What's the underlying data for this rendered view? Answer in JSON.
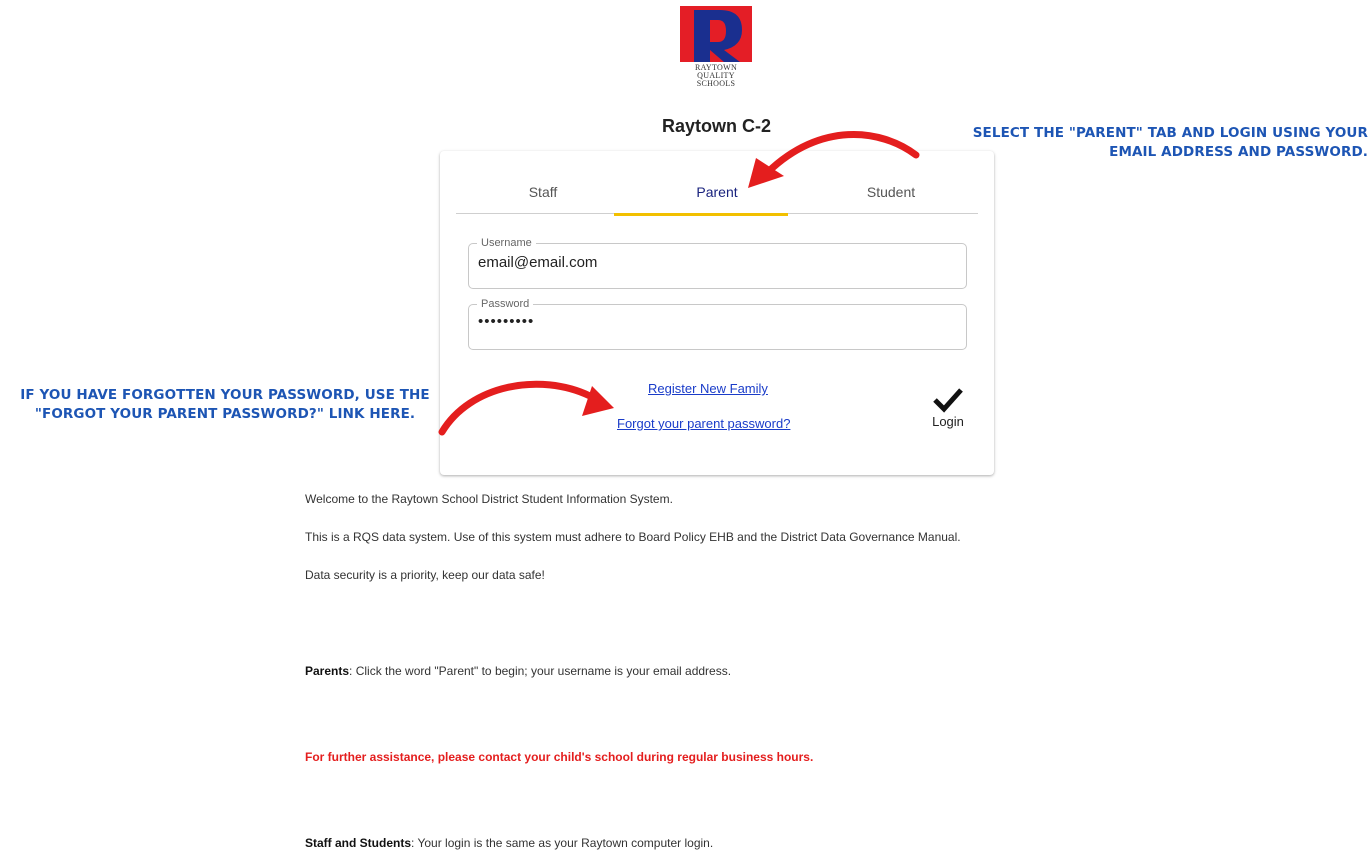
{
  "logo": {
    "lines": [
      "RAYTOWN",
      "QUALITY",
      "SCHOOLS"
    ]
  },
  "title": "Raytown C-2",
  "tabs": [
    {
      "label": "Staff"
    },
    {
      "label": "Parent"
    },
    {
      "label": "Student"
    }
  ],
  "username": {
    "label": "Username",
    "value": "email@email.com"
  },
  "password": {
    "label": "Password",
    "value": "•••••••••"
  },
  "links": {
    "register": "Register New Family",
    "forgot": "Forgot your parent password?"
  },
  "login": {
    "label": "Login",
    "icon": "checkmark-icon"
  },
  "annotations": {
    "parent_tab": "SELECT THE \"PARENT\" TAB AND LOGIN USING YOUR EMAIL ADDRESS AND PASSWORD.",
    "forgot": "IF YOU HAVE FORGOTTEN YOUR PASSWORD, USE THE \"FORGOT YOUR PARENT PASSWORD?\" LINK HERE."
  },
  "info": {
    "welcome": "Welcome to the Raytown School District Student Information System.",
    "policy": "This is a RQS data system. Use of this system must adhere to Board Policy EHB and the District Data Governance Manual.",
    "security": "Data security is a priority, keep our data safe!",
    "parents_label": "Parents",
    "parents_text": ": Click the word \"Parent\" to begin; your username is your email address.",
    "assistance": "For further assistance, please contact your child's school during regular business hours.",
    "staff_label": "Staff and Students",
    "staff_text": ": Your login is the same as your Raytown computer login."
  },
  "colors": {
    "accent": "#f2c000",
    "link": "#1a3cc9",
    "annotation": "#1d55b4",
    "arrow": "#e41e1e",
    "logo_blue": "#1a2f8f",
    "logo_red": "#e41e26"
  }
}
